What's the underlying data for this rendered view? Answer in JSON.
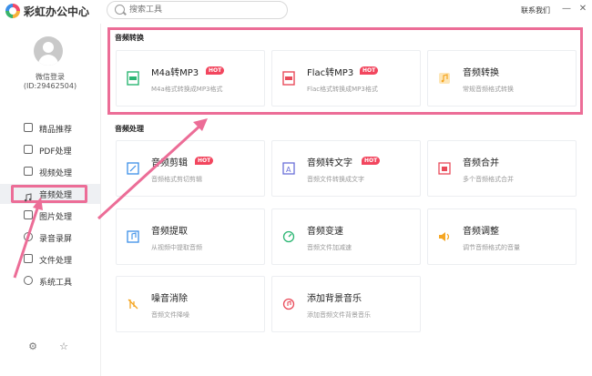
{
  "app": {
    "title": "彩虹办公中心"
  },
  "search": {
    "placeholder": "搜索工具"
  },
  "header": {
    "contact": "联系我们",
    "minimize": "—",
    "close": "✕"
  },
  "user": {
    "login": "微信登录",
    "id": "(ID:29462504)"
  },
  "nav": [
    {
      "label": "精品推荐",
      "icon": "thumb-up-icon"
    },
    {
      "label": "PDF处理",
      "icon": "pdf-icon"
    },
    {
      "label": "视频处理",
      "icon": "video-icon"
    },
    {
      "label": "音频处理",
      "icon": "music-note-icon",
      "active": true
    },
    {
      "label": "图片处理",
      "icon": "image-icon"
    },
    {
      "label": "录音录屏",
      "icon": "record-icon"
    },
    {
      "label": "文件处理",
      "icon": "folder-icon"
    },
    {
      "label": "系统工具",
      "icon": "tools-icon"
    }
  ],
  "sections": [
    {
      "title": "音频转换",
      "cards": [
        {
          "title": "M4a转MP3",
          "hot": "HOT",
          "desc": "M4a格式转换成MP3格式",
          "icon": "m4a-file-icon",
          "color": "#2bb673"
        },
        {
          "title": "Flac转MP3",
          "hot": "HOT",
          "desc": "Flac格式转换成MP3格式",
          "icon": "flac-file-icon",
          "color": "#e94b5a"
        },
        {
          "title": "音频转换",
          "desc": "常规音频格式转换",
          "icon": "audio-convert-icon",
          "color": "#f5a623"
        }
      ]
    },
    {
      "title": "音频处理",
      "cards": [
        {
          "title": "音频剪辑",
          "hot": "HOT",
          "desc": "音频格式剪切剪辑",
          "icon": "audio-cut-icon",
          "color": "#3b8fe8"
        },
        {
          "title": "音频转文字",
          "hot": "HOT",
          "desc": "音频文件转换成文字",
          "icon": "audio-to-text-icon",
          "color": "#6a6fd8"
        },
        {
          "title": "音频合并",
          "desc": "多个音频格式合并",
          "icon": "audio-merge-icon",
          "color": "#e94b5a"
        },
        {
          "title": "音频提取",
          "desc": "从视频中提取音频",
          "icon": "audio-extract-icon",
          "color": "#3b8fe8"
        },
        {
          "title": "音频变速",
          "desc": "音频文件加减速",
          "icon": "audio-speed-icon",
          "color": "#2bb673"
        },
        {
          "title": "音频调整",
          "desc": "调节音频格式的音量",
          "icon": "volume-icon",
          "color": "#f5a623"
        },
        {
          "title": "噪音消除",
          "desc": "音频文件降噪",
          "icon": "noise-remove-icon",
          "color": "#f5a623"
        },
        {
          "title": "添加背景音乐",
          "desc": "添加音频文件背景音乐",
          "icon": "bgm-add-icon",
          "color": "#e94b5a"
        }
      ]
    }
  ],
  "colors": {
    "highlight": "#ec6d97",
    "hot": "#f2465e"
  }
}
